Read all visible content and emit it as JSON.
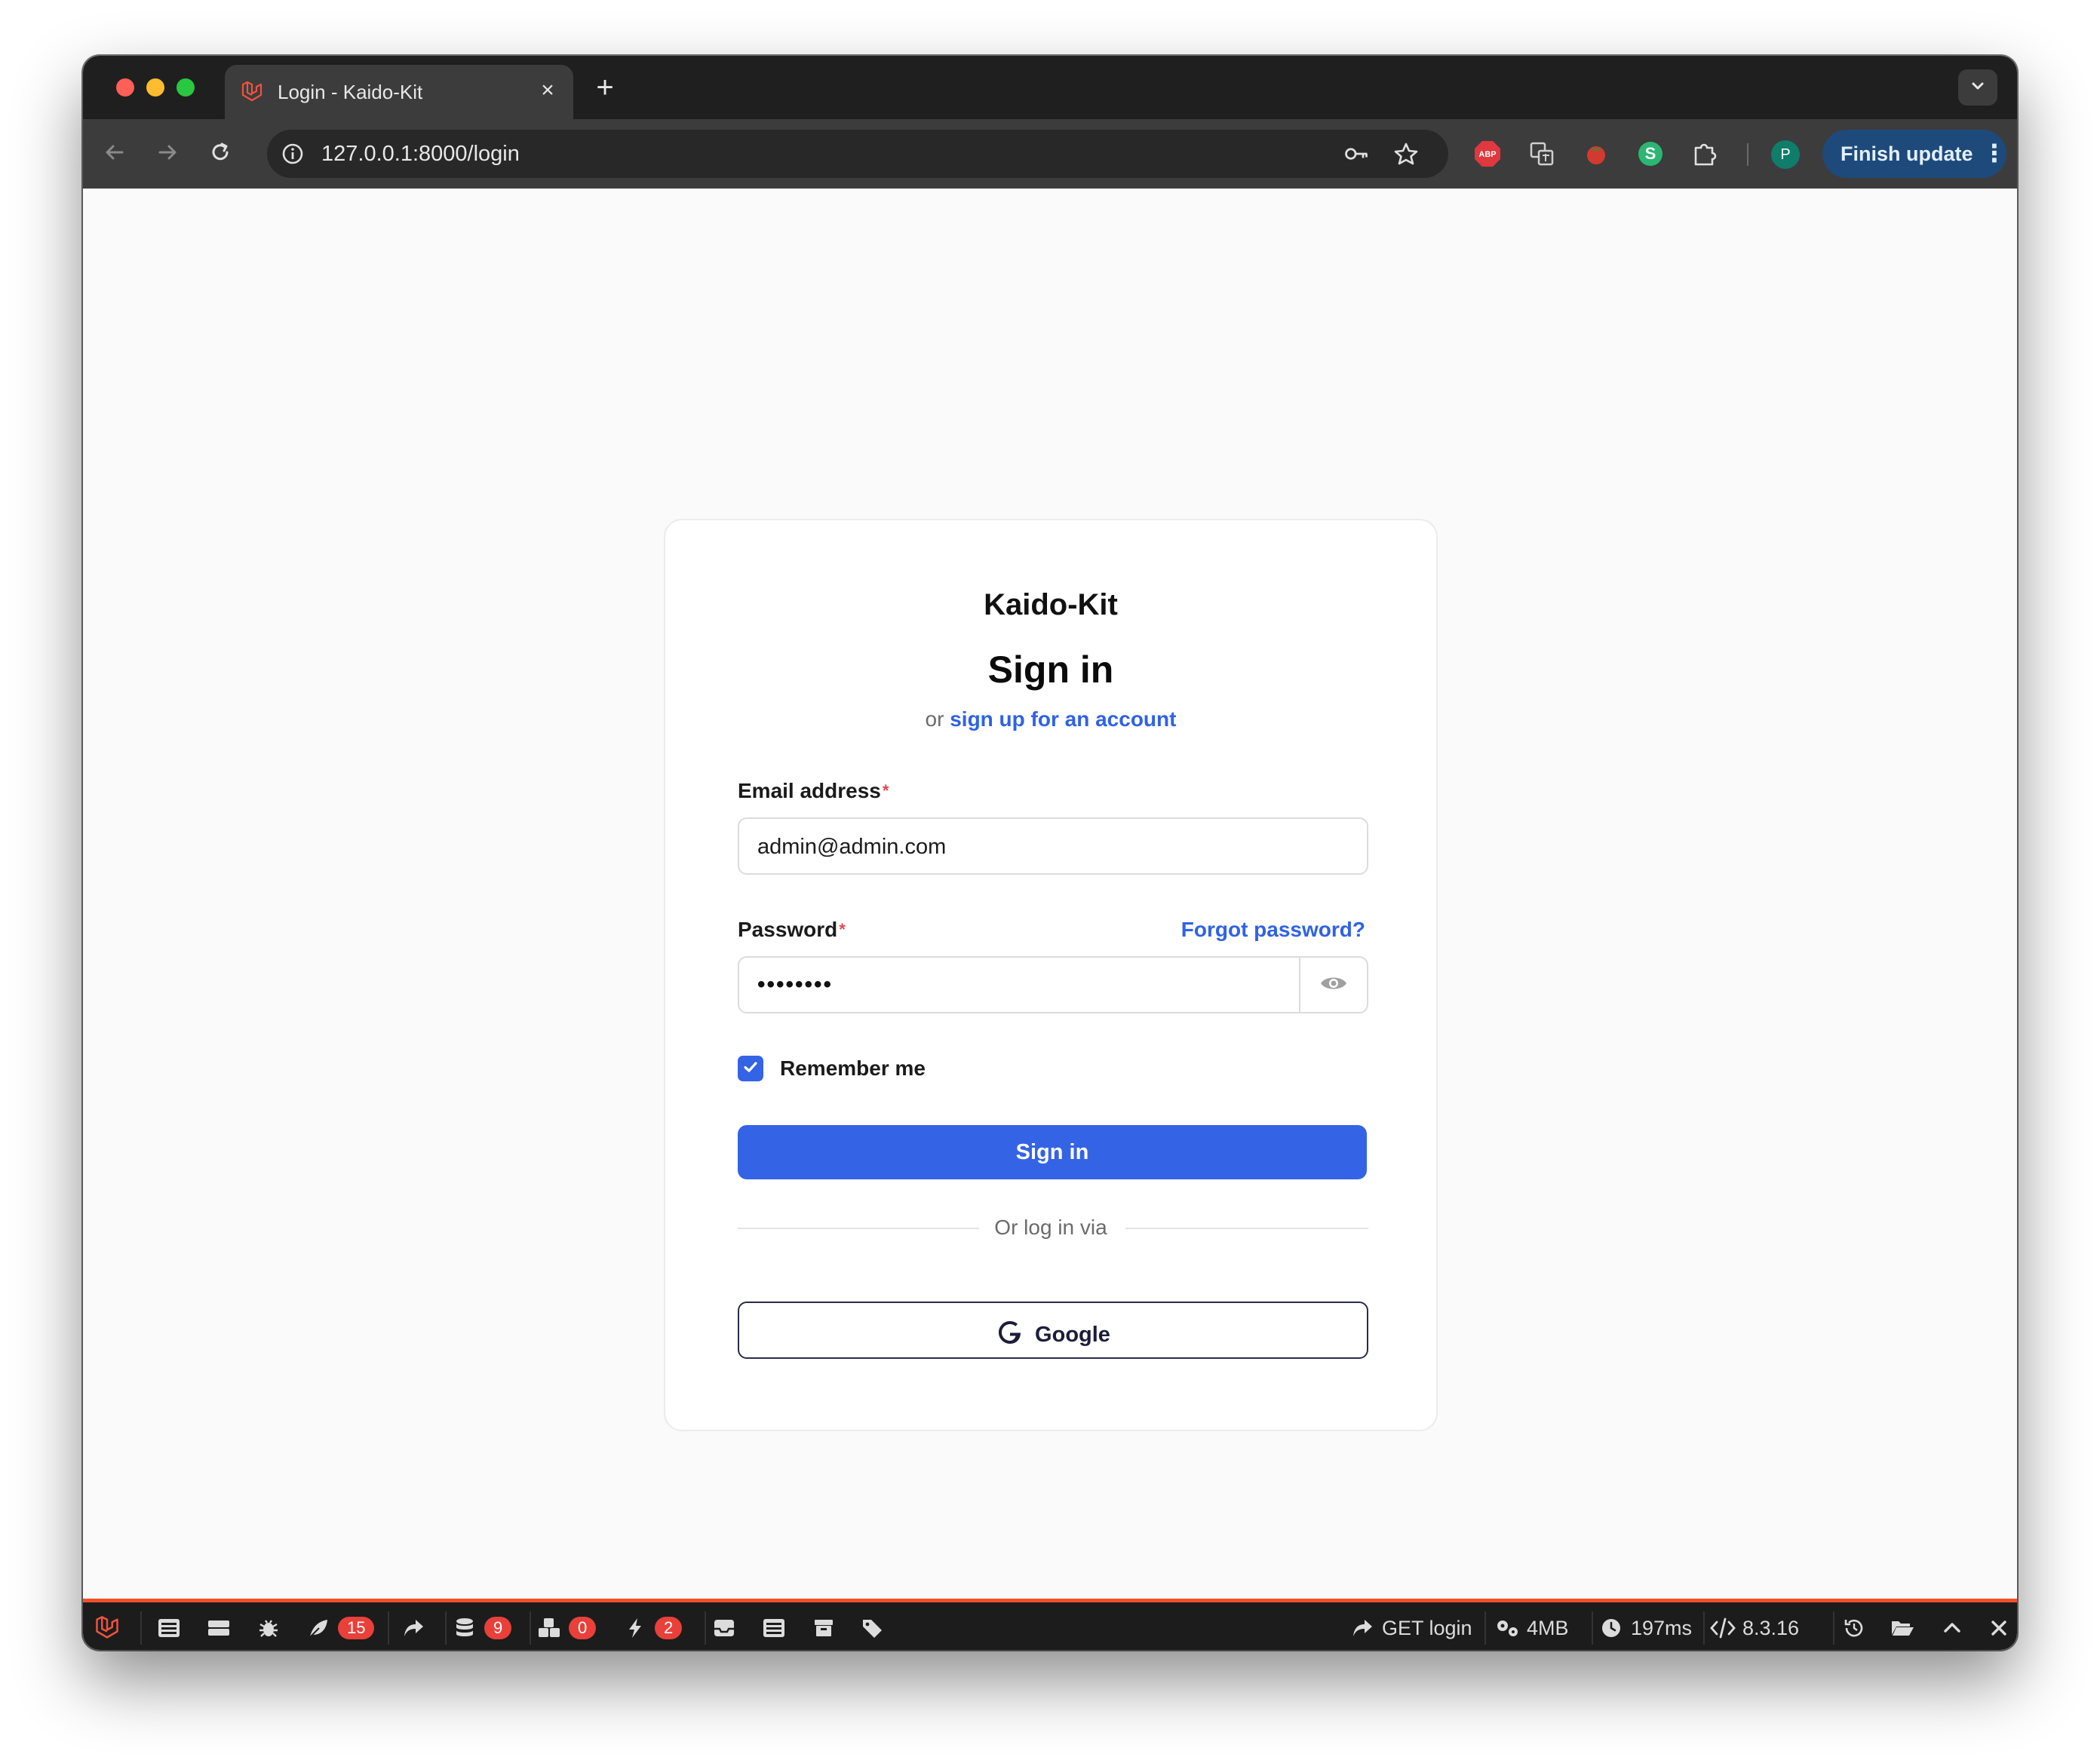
{
  "browser": {
    "tab_title": "Login - Kaido-Kit",
    "url": "127.0.0.1:8000/login",
    "finish_update_label": "Finish update",
    "profile_initial": "P",
    "extensions": [
      "adblock-icon",
      "translate-icon",
      "tomato-icon",
      "s-extension-icon",
      "puzzle-icon"
    ]
  },
  "login": {
    "brand": "Kaido-Kit",
    "heading": "Sign in",
    "subline_prefix": "or",
    "signup_link": "sign up for an account",
    "email_label": "Email address",
    "email_value": "admin@admin.com",
    "password_label": "Password",
    "forgot_link": "Forgot password?",
    "password_value": "••••••••",
    "remember_label": "Remember me",
    "remember_checked": true,
    "submit_label": "Sign in",
    "divider_text": "Or log in via",
    "google_label": "Google",
    "required_mark": "*"
  },
  "debugbar": {
    "badges": {
      "views": "15",
      "queries": "9",
      "models": "0",
      "events": "2"
    },
    "request": "GET login",
    "memory": "4MB",
    "time": "197ms",
    "php_version": "8.3.16"
  },
  "colors": {
    "accent": "#3463e6",
    "link": "#2f62e8",
    "required": "#e5484d",
    "debugbar_accent": "#f4502b",
    "badge": "#e9403a"
  }
}
